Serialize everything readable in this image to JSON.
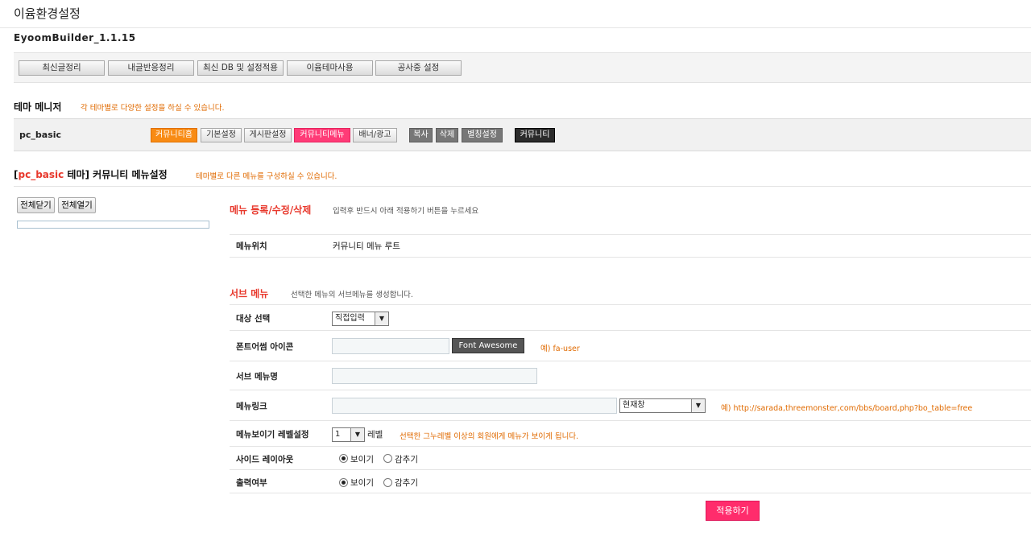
{
  "page": {
    "title": "이윰환경설정",
    "version": "EyoomBuilder_1.1.15"
  },
  "toolbar": {
    "buttons": [
      "최신글정리",
      "내글반응정리",
      "최신 DB 및 설정적용",
      "이윰테마사용",
      "공사중 설정"
    ]
  },
  "theme_manager": {
    "title": "테마 메니저",
    "desc": "각 테마별로 다양한 설정을 하실 수 있습니다.",
    "theme_name": "pc_basic",
    "buttons": [
      "커뮤니티홈",
      "기본설정",
      "게시판설정",
      "커뮤니티메뉴",
      "배너/광고",
      "복사",
      "삭제",
      "별칭설정",
      "커뮤니티"
    ]
  },
  "menu_settings": {
    "title_bracket_open": "[",
    "title_theme": "pc_basic",
    "title_rest": " 테마] 커뮤니티 메뉴설정",
    "desc": "테마별로 다른 메뉴를 구성하실 수 있습니다."
  },
  "tree": {
    "collapse_all": "전체닫기",
    "expand_all": "전체열기"
  },
  "menu_edit": {
    "title": "메뉴 등록/수정/삭제",
    "desc": "입력후 반드시 아래 적용하기 버튼을 누르세요",
    "location_label": "메뉴위치",
    "location_value": "커뮤니티 메뉴 루트"
  },
  "sub_menu": {
    "title": "서브 메뉴",
    "desc": "선택한 메뉴의 서브메뉴를 생성합니다.",
    "target_label": "대상 선택",
    "target_value": "직접입력",
    "icon_label": "폰트어썸 아이콘",
    "icon_value": "",
    "fa_button": "Font Awesome",
    "icon_hint": "예) fa-user",
    "name_label": "서브 메뉴명",
    "name_value": "",
    "link_label": "메뉴링크",
    "link_value": "",
    "link_target": "현재창",
    "link_hint": "예) http://sarada,threemonster,com/bbs/board,php?bo_table=free",
    "level_label": "메뉴보이기 레벨설정",
    "level_value": "1",
    "level_unit": "레벨",
    "level_hint": "선택한 그누레벨 이상의 회원에게 메뉴가 보이게 됩니다.",
    "side_label": "사이드 레이아웃",
    "output_label": "출력여부",
    "show": "보이기",
    "hide": "감추기",
    "side_selected": "show",
    "output_selected": "show",
    "apply": "적용하기"
  },
  "colors": {
    "orange": "#f88b14",
    "pink": "#ff3b77",
    "red_title": "#e8382c",
    "hint": "#e06a00"
  }
}
